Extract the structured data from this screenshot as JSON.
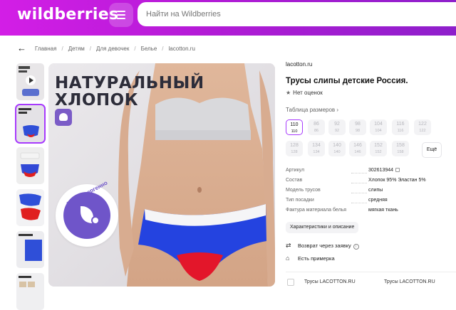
{
  "header": {
    "logo": "wildberries",
    "search_placeholder": "Найти на Wildberries"
  },
  "breadcrumbs": [
    "Главная",
    "Детям",
    "Для девочек",
    "Белье",
    "lacotton.ru"
  ],
  "gallery": {
    "headline_line1": "НАТУРАЛЬНЫЙ",
    "headline_line2": "ХЛОПОК",
    "badge_text": "гипоаллергенно",
    "thumbnails": [
      "video",
      "photo-1",
      "photo-2",
      "photo-3",
      "photo-4",
      "photo-5"
    ]
  },
  "product": {
    "brand": "lacotton.ru",
    "title": "Трусы слипы детские Россия.",
    "rating_text": "Нет оценок",
    "size_table_link": "Таблица размеров",
    "sizes": [
      {
        "size": "110",
        "sub": "110",
        "selected": true
      },
      {
        "size": "86",
        "sub": "86",
        "selected": false
      },
      {
        "size": "92",
        "sub": "92",
        "selected": false
      },
      {
        "size": "98",
        "sub": "98",
        "selected": false
      },
      {
        "size": "104",
        "sub": "104",
        "selected": false
      },
      {
        "size": "116",
        "sub": "116",
        "selected": false
      },
      {
        "size": "122",
        "sub": "122",
        "selected": false
      },
      {
        "size": "128",
        "sub": "128",
        "selected": false
      },
      {
        "size": "134",
        "sub": "134",
        "selected": false
      },
      {
        "size": "140",
        "sub": "140",
        "selected": false
      },
      {
        "size": "146",
        "sub": "146",
        "selected": false
      },
      {
        "size": "152",
        "sub": "152",
        "selected": false
      },
      {
        "size": "158",
        "sub": "158",
        "selected": false
      }
    ],
    "more_sizes": "Ещё",
    "specs": [
      {
        "key": "Артикул",
        "value": "302613944"
      },
      {
        "key": "Состав",
        "value": "Хлопок 95% Эластан 5%"
      },
      {
        "key": "Модель трусов",
        "value": "слипы"
      },
      {
        "key": "Тип посадки",
        "value": "средняя"
      },
      {
        "key": "Фактура материала белья",
        "value": "мягкая ткань"
      }
    ],
    "characteristics_button": "Характеристики и описание",
    "return_text": "Возврат через заявку",
    "fitting_text": "Есть примерка",
    "bottom_left": "Трусы LACOTTON.RU",
    "bottom_right": "Трусы LACOTTON.RU"
  },
  "colors": {
    "header_start": "#d31ee6",
    "header_end": "#8e1fcb",
    "accent": "#a73afd"
  }
}
